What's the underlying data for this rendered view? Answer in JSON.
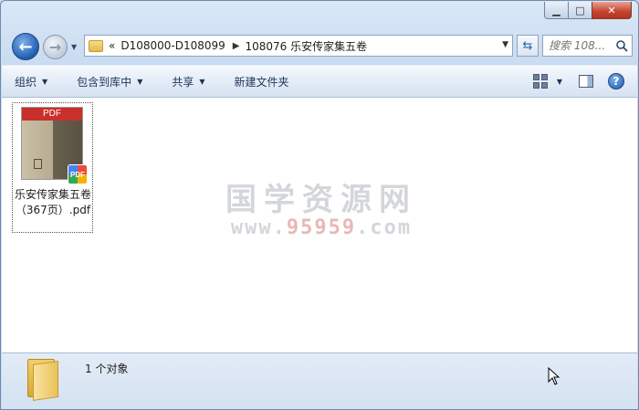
{
  "window": {
    "minimize_glyph": "▁",
    "maximize_glyph": "□",
    "close_glyph": "✕"
  },
  "nav": {
    "back_glyph": "←",
    "forward_glyph": "→",
    "history_glyph": "▼"
  },
  "address": {
    "overflow": "«",
    "breadcrumbs": [
      {
        "label": "D108000-D108099"
      },
      {
        "label": "108076 乐安传家集五卷"
      }
    ],
    "separator": "▶",
    "dropdown_glyph": "▼"
  },
  "refresh_glyph": "⇆",
  "search": {
    "placeholder": "搜索 108..."
  },
  "toolbar": {
    "organize": "组织",
    "include_in_library": "包含到库中",
    "share": "共享",
    "new_folder": "新建文件夹",
    "dropdown_glyph": "▼",
    "help_glyph": "?"
  },
  "files": [
    {
      "name": "乐安传家集五卷（367页）.pdf",
      "thumb_band": "PDF",
      "badge": "PDF",
      "type": "pdf"
    }
  ],
  "watermark": {
    "title": "国学资源网",
    "url_prefix": "www.",
    "url_highlight": "95959",
    "url_suffix": ".com"
  },
  "status": {
    "count_text": "1 个对象"
  },
  "colors": {
    "accent": "#1f5db4",
    "pdf_band": "#c8302b"
  }
}
